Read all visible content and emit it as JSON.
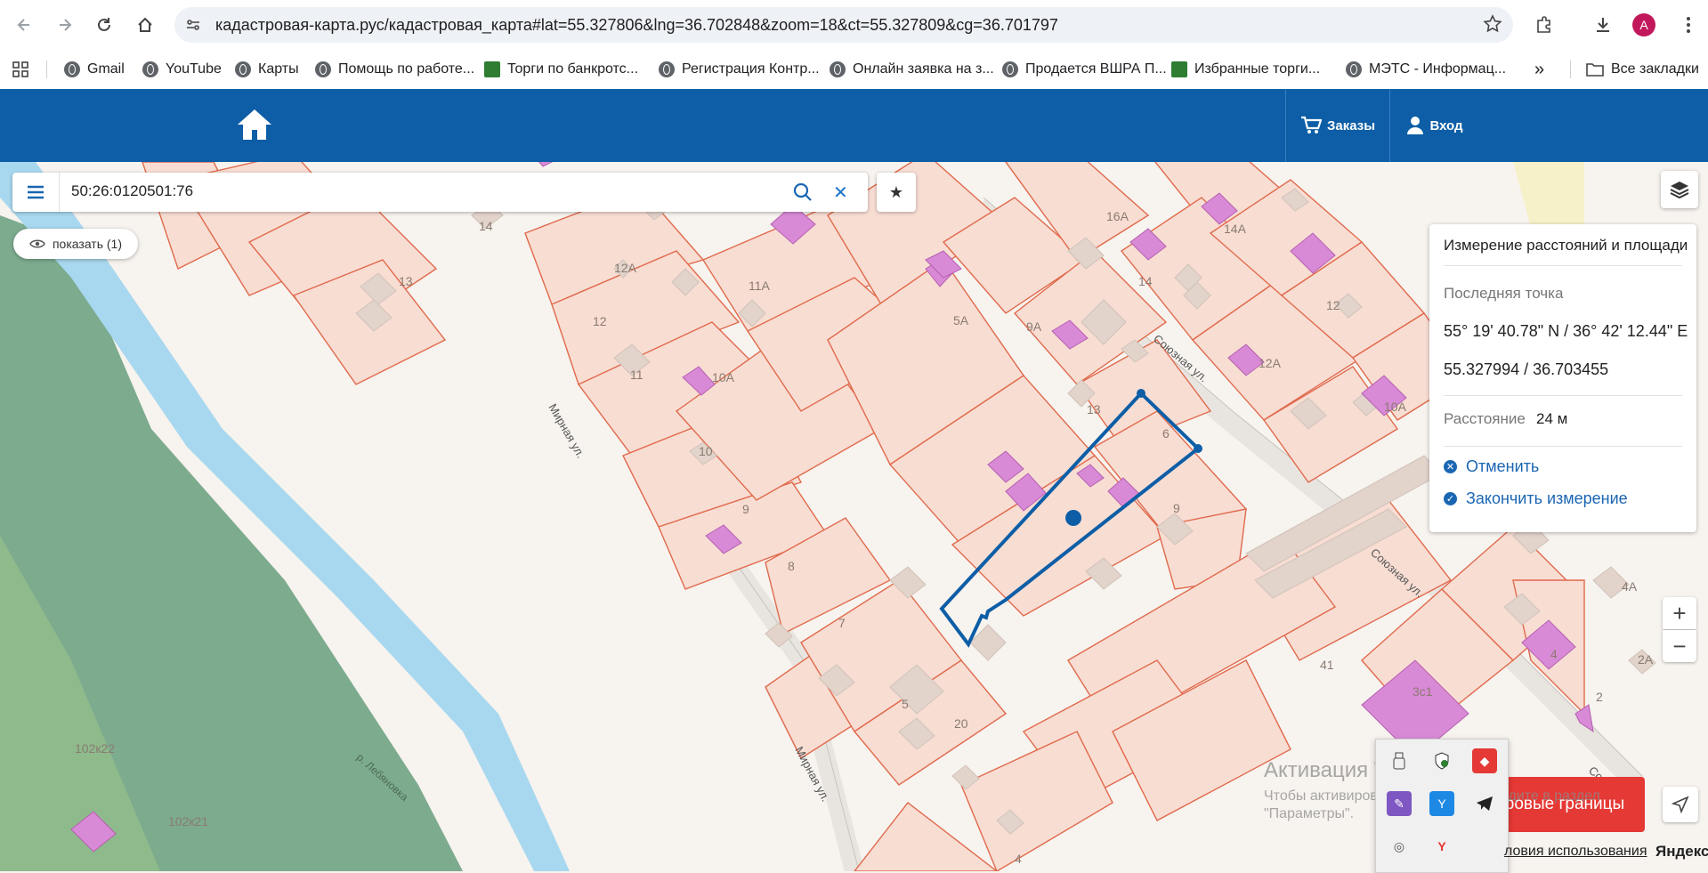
{
  "browser": {
    "url": "кадастровая-карта.рус/кадастровая_карта#lat=55.327806&lng=36.702848&zoom=18&ct=55.327809&cg=36.701797",
    "profile_initial": "A",
    "bookmarks": [
      {
        "label": "Gmail",
        "icon": "globe"
      },
      {
        "label": "YouTube",
        "icon": "globe"
      },
      {
        "label": "Карты",
        "icon": "globe"
      },
      {
        "label": "Помощь по работе...",
        "icon": "globe"
      },
      {
        "label": "Торги по банкротс...",
        "icon": "hammer"
      },
      {
        "label": "Регистрация Контр...",
        "icon": "globe"
      },
      {
        "label": "Онлайн заявка на з...",
        "icon": "globe"
      },
      {
        "label": "Продается ВШРА П...",
        "icon": "globe"
      },
      {
        "label": "Избранные торги...",
        "icon": "hammer"
      },
      {
        "label": "МЭТС - Информац...",
        "icon": "globe"
      }
    ],
    "all_bookmarks_label": "Все закладки"
  },
  "header": {
    "orders_label": "Заказы",
    "login_label": "Вход",
    "brand_color": "#0d5ea6"
  },
  "search": {
    "value": "50:26:0120501:76",
    "show_label": "показать (1)"
  },
  "measure": {
    "title": "Измерение расстояний и площади",
    "last_point_label": "Последняя точка",
    "coords_dms": "55° 19' 40.78\" N / 36° 42' 12.44\" E",
    "coords_dec": "55.327994 / 36.703455",
    "distance_label": "Расстояние",
    "distance_value": "24 м",
    "cancel_label": "Отменить",
    "finish_label": "Закончить измерение"
  },
  "map": {
    "plot_numbers": [
      "16А",
      "14А",
      "14",
      "12",
      "12А",
      "10А",
      "13",
      "6",
      "9",
      "5А",
      "9А",
      "14",
      "13",
      "12А",
      "11А",
      "12",
      "11",
      "10А",
      "10",
      "9",
      "8",
      "7",
      "5",
      "20",
      "41",
      "3с1",
      "4А",
      "4",
      "2А",
      "2",
      "102к22",
      "102к21",
      "4"
    ],
    "streets": [
      "Мирная ул.",
      "Мирная ул.",
      "Союзная ул.",
      "Союзная ул."
    ],
    "river_label": "р. Лебяновка",
    "colors": {
      "parcel_fill": "#f8ddd3",
      "parcel_stroke": "#e06a4c",
      "building": "#d98ad6",
      "selected_outline": "#0d5ea6",
      "water": "#a8d8ef",
      "forest": "#7dab8e"
    }
  },
  "controls": {
    "zoom_in": "+",
    "zoom_out": "−",
    "borders_button": "ровые границы"
  },
  "watermark": {
    "title": "Активация Windows",
    "line1": "Чтобы активировать Windows, перейдите в раздел",
    "line2": "\"Параметры\"."
  },
  "footer": {
    "terms": "ловия использования",
    "yandex": "Яндекс"
  }
}
